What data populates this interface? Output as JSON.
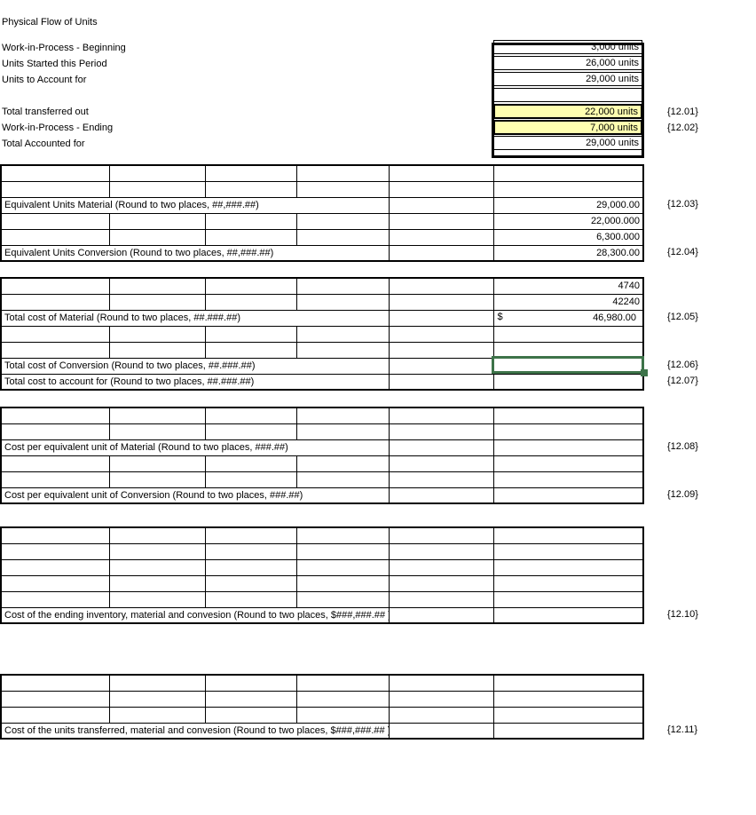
{
  "document": {
    "title": "Physical Flow of Units",
    "colors": {
      "input_fill": "#ffffb0",
      "selection_border": "#3d7349",
      "gridline": "#000000",
      "background": "#ffffff"
    }
  },
  "sections": {
    "physical_flow": {
      "rows": [
        {
          "label": "Work-in-Process - Beginning",
          "value": "3,000 units",
          "fill": "white",
          "ref": ""
        },
        {
          "label": "Units Started this Period",
          "value": "26,000 units",
          "fill": "white",
          "ref": ""
        },
        {
          "label": "Units to Account for",
          "value": "29,000 units",
          "fill": "white",
          "ref": ""
        },
        {
          "label": "",
          "value": "",
          "fill": "white",
          "ref": ""
        },
        {
          "label": "Total transferred out",
          "value": "22,000 units",
          "fill": "yellow",
          "ref": "{12.01}"
        },
        {
          "label": "Work-in-Process - Ending",
          "value": "7,000 units",
          "fill": "yellow",
          "ref": "{12.02}"
        },
        {
          "label": "Total Accounted for",
          "value": "29,000 units",
          "fill": "white",
          "ref": ""
        }
      ]
    },
    "equivalent_units": {
      "rows": [
        {
          "label": "",
          "value": "",
          "fill": "white",
          "ref": ""
        },
        {
          "label": "",
          "value": "",
          "fill": "white",
          "ref": ""
        },
        {
          "label": "Equivalent Units Material (Round to two places, ##,###.##)",
          "value": "29,000.00",
          "fill": "yellow",
          "ref": "{12.03}"
        },
        {
          "label": "",
          "value": "22,000.000",
          "fill": "white",
          "ref": ""
        },
        {
          "label": "",
          "value": "6,300.000",
          "fill": "white",
          "ref": ""
        },
        {
          "label": "Equivalent Units Conversion (Round to two places, ##,###.##)",
          "value": "28,300.00",
          "fill": "yellow",
          "ref": "{12.04}"
        }
      ]
    },
    "total_costs": {
      "rows": [
        {
          "label": "",
          "value": "4740",
          "fill": "white",
          "ref": ""
        },
        {
          "label": "",
          "value": "42240",
          "fill": "white",
          "ref": ""
        },
        {
          "label": "Total cost of Material (Round to two places, ##.###.##)",
          "value": "46,980.00",
          "currency": "$",
          "fill": "yellow",
          "ref": "{12.05}"
        },
        {
          "label": "",
          "value": "",
          "fill": "white",
          "ref": ""
        },
        {
          "label": "",
          "value": "",
          "fill": "white",
          "ref": ""
        },
        {
          "label": "Total cost of Conversion (Round to two places, ##.###.##)",
          "value": "",
          "fill": "yellow",
          "ref": "{12.06}",
          "selected": true
        },
        {
          "label": "Total cost to account for (Round to two places, ##.###.##)",
          "value": "",
          "fill": "yellow",
          "ref": "{12.07}"
        }
      ]
    },
    "cost_per_unit": {
      "rows": [
        {
          "label": "",
          "value": "",
          "fill": "white",
          "ref": ""
        },
        {
          "label": "",
          "value": "",
          "fill": "white",
          "ref": ""
        },
        {
          "label": "Cost per equivalent unit of Material (Round to two places, ###.##)",
          "value": "",
          "fill": "yellow",
          "ref": "{12.08}"
        },
        {
          "label": "",
          "value": "",
          "fill": "white",
          "ref": ""
        },
        {
          "label": "",
          "value": "",
          "fill": "white",
          "ref": ""
        },
        {
          "label": "Cost per equivalent unit of Conversion (Round to two places, ###.##)",
          "value": "",
          "fill": "yellow",
          "ref": "{12.09}"
        }
      ]
    },
    "ending_inventory": {
      "rows": [
        {
          "label": "",
          "value": "",
          "fill": "white",
          "ref": ""
        },
        {
          "label": "",
          "value": "",
          "fill": "white",
          "ref": ""
        },
        {
          "label": "",
          "value": "",
          "fill": "white",
          "ref": ""
        },
        {
          "label": "",
          "value": "",
          "fill": "white",
          "ref": ""
        },
        {
          "label": "",
          "value": "",
          "fill": "white",
          "ref": ""
        },
        {
          "label": "Cost of the ending inventory, material and convesion (Round to two places, $###,###.## )",
          "value": "",
          "fill": "yellow",
          "ref": "{12.10}"
        }
      ]
    },
    "transferred_units": {
      "rows": [
        {
          "label": "",
          "value": "",
          "fill": "white",
          "ref": ""
        },
        {
          "label": "",
          "value": "",
          "fill": "white",
          "ref": ""
        },
        {
          "label": "",
          "value": "",
          "fill": "white",
          "ref": ""
        },
        {
          "label": "Cost of the units transferred, material and convesion (Round to two places, $###,###.## )",
          "value": "",
          "fill": "yellow",
          "ref": "{12.11}"
        }
      ]
    }
  }
}
